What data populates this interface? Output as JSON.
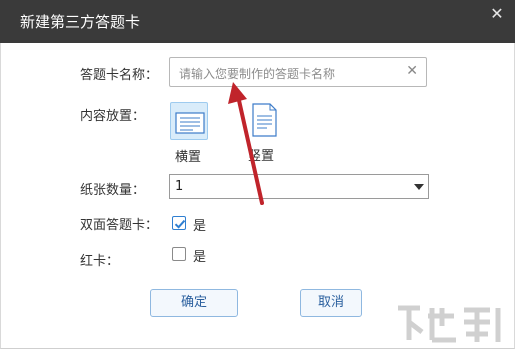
{
  "dialog": {
    "title": "新建第三方答题卡",
    "close_glyph": "✕"
  },
  "form": {
    "name_label": "答题卡名称：",
    "name_placeholder": "请输入您要制作的答题卡名称",
    "clear_glyph": "✕",
    "layout_label": "内容放置：",
    "layout_options": [
      {
        "label": "横置",
        "selected": true
      },
      {
        "label": "竖置",
        "selected": false
      }
    ],
    "quantity_label": "纸张数量：",
    "quantity_value": "1",
    "duplex_label": "双面答题卡：",
    "duplex_option": "是",
    "duplex_checked": true,
    "redcard_label": "红卡：",
    "redcard_option": "是",
    "redcard_checked": false
  },
  "buttons": {
    "confirm": "确定",
    "cancel": "取消"
  },
  "colors": {
    "titlebar": "#3a3a3a",
    "selected_bg": "#d9ecfa",
    "annotation_arrow": "#c0242b",
    "button_text": "#2a5f9e"
  }
}
